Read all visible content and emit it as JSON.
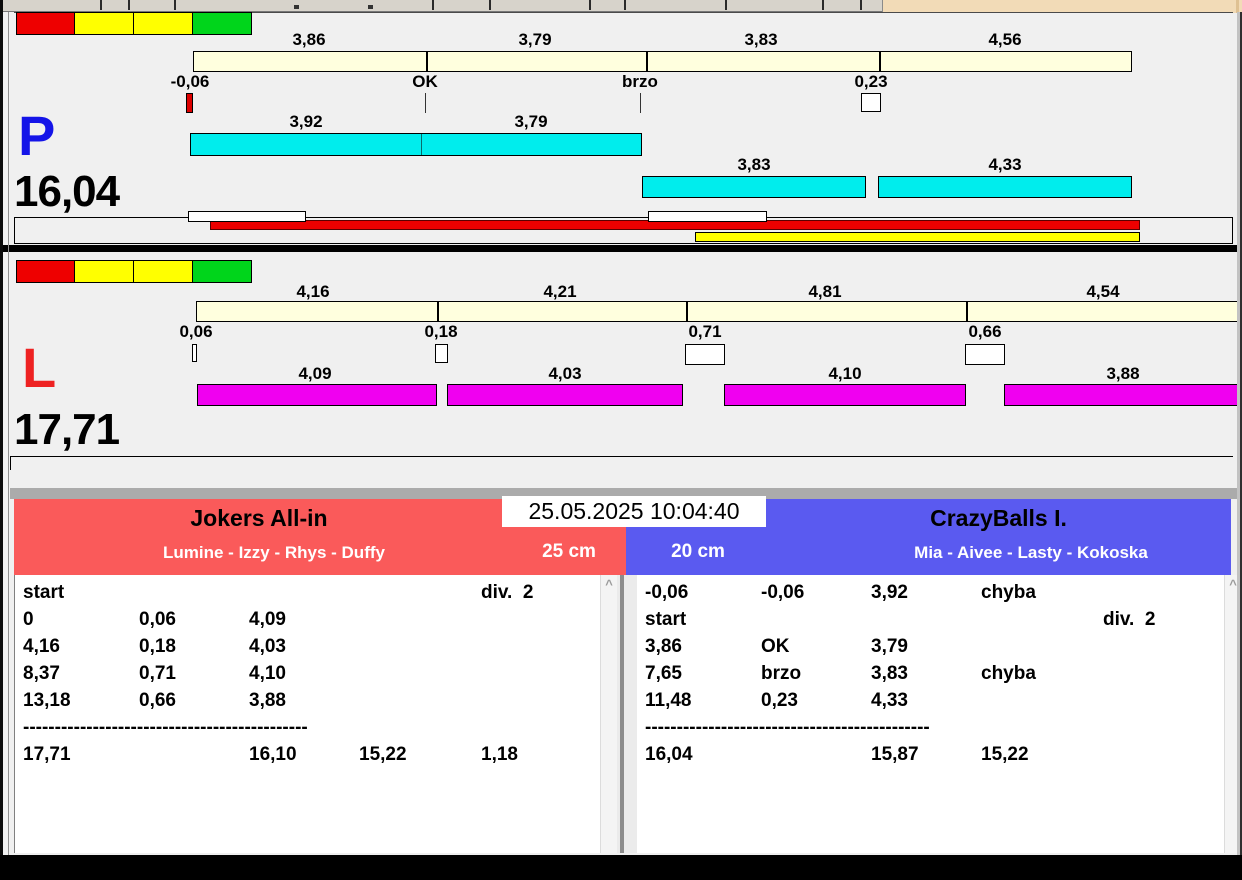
{
  "datetime": "25.05.2025 10:04:40",
  "ui": {
    "scroll_up_glyph": "^"
  },
  "panel_p": {
    "letter": "P",
    "letter_color": "#1414E8",
    "total": "16,04",
    "lights": [
      "#EE0000",
      "#FFFF00",
      "#FFFF00",
      "#00D51B"
    ],
    "splits": [
      "3,86",
      "3,79",
      "3,83",
      "4,56"
    ],
    "exchanges": [
      "-0,06",
      "OK",
      "brzo",
      "0,23"
    ],
    "dogs_row1": [
      "3,92",
      "3,79"
    ],
    "dogs_row2": [
      "3,83",
      "4,33"
    ]
  },
  "panel_l": {
    "letter": "L",
    "letter_color": "#EE2222",
    "total": "17,71",
    "lights": [
      "#EE0000",
      "#FFFF00",
      "#FFFF00",
      "#00D51B"
    ],
    "splits": [
      "4,16",
      "4,21",
      "4,81",
      "4,54"
    ],
    "exchanges": [
      "0,06",
      "0,18",
      "0,71",
      "0,66"
    ],
    "dogs": [
      "4,09",
      "4,03",
      "4,10",
      "3,88"
    ]
  },
  "left_team": {
    "name": "Jokers All-in",
    "members": "Lumine - Izzy - Rhys - Duffy",
    "height": "25 cm",
    "accent": "#FA5A5A",
    "dashes": "---------------------------------------------",
    "rows": [
      [
        "start",
        "",
        "",
        "",
        "div.  2"
      ],
      [
        "0",
        "0,06",
        "4,09",
        "",
        ""
      ],
      [
        "4,16",
        "0,18",
        "4,03",
        "",
        ""
      ],
      [
        "8,37",
        "0,71",
        "4,10",
        "",
        ""
      ],
      [
        "13,18",
        "0,66",
        "3,88",
        "",
        ""
      ],
      [
        "17,71",
        "",
        "16,10",
        "15,22",
        "1,18"
      ]
    ]
  },
  "right_team": {
    "name": "CrazyBalls I.",
    "members": "Mia - Aivee - Lasty - Kokoska",
    "height": "20 cm",
    "accent": "#5A5AF0",
    "dashes": "---------------------------------------------",
    "rows": [
      [
        "-0,06",
        "-0,06",
        "3,92",
        "chyba",
        ""
      ],
      [
        "start",
        "",
        "",
        "",
        "div.  2"
      ],
      [
        "3,86",
        "OK",
        "3,79",
        "",
        ""
      ],
      [
        "7,65",
        "brzo",
        "3,83",
        "chyba",
        ""
      ],
      [
        "11,48",
        "0,23",
        "4,33",
        "",
        ""
      ],
      [
        "16,04",
        "",
        "15,87",
        "15,22",
        ""
      ]
    ]
  }
}
